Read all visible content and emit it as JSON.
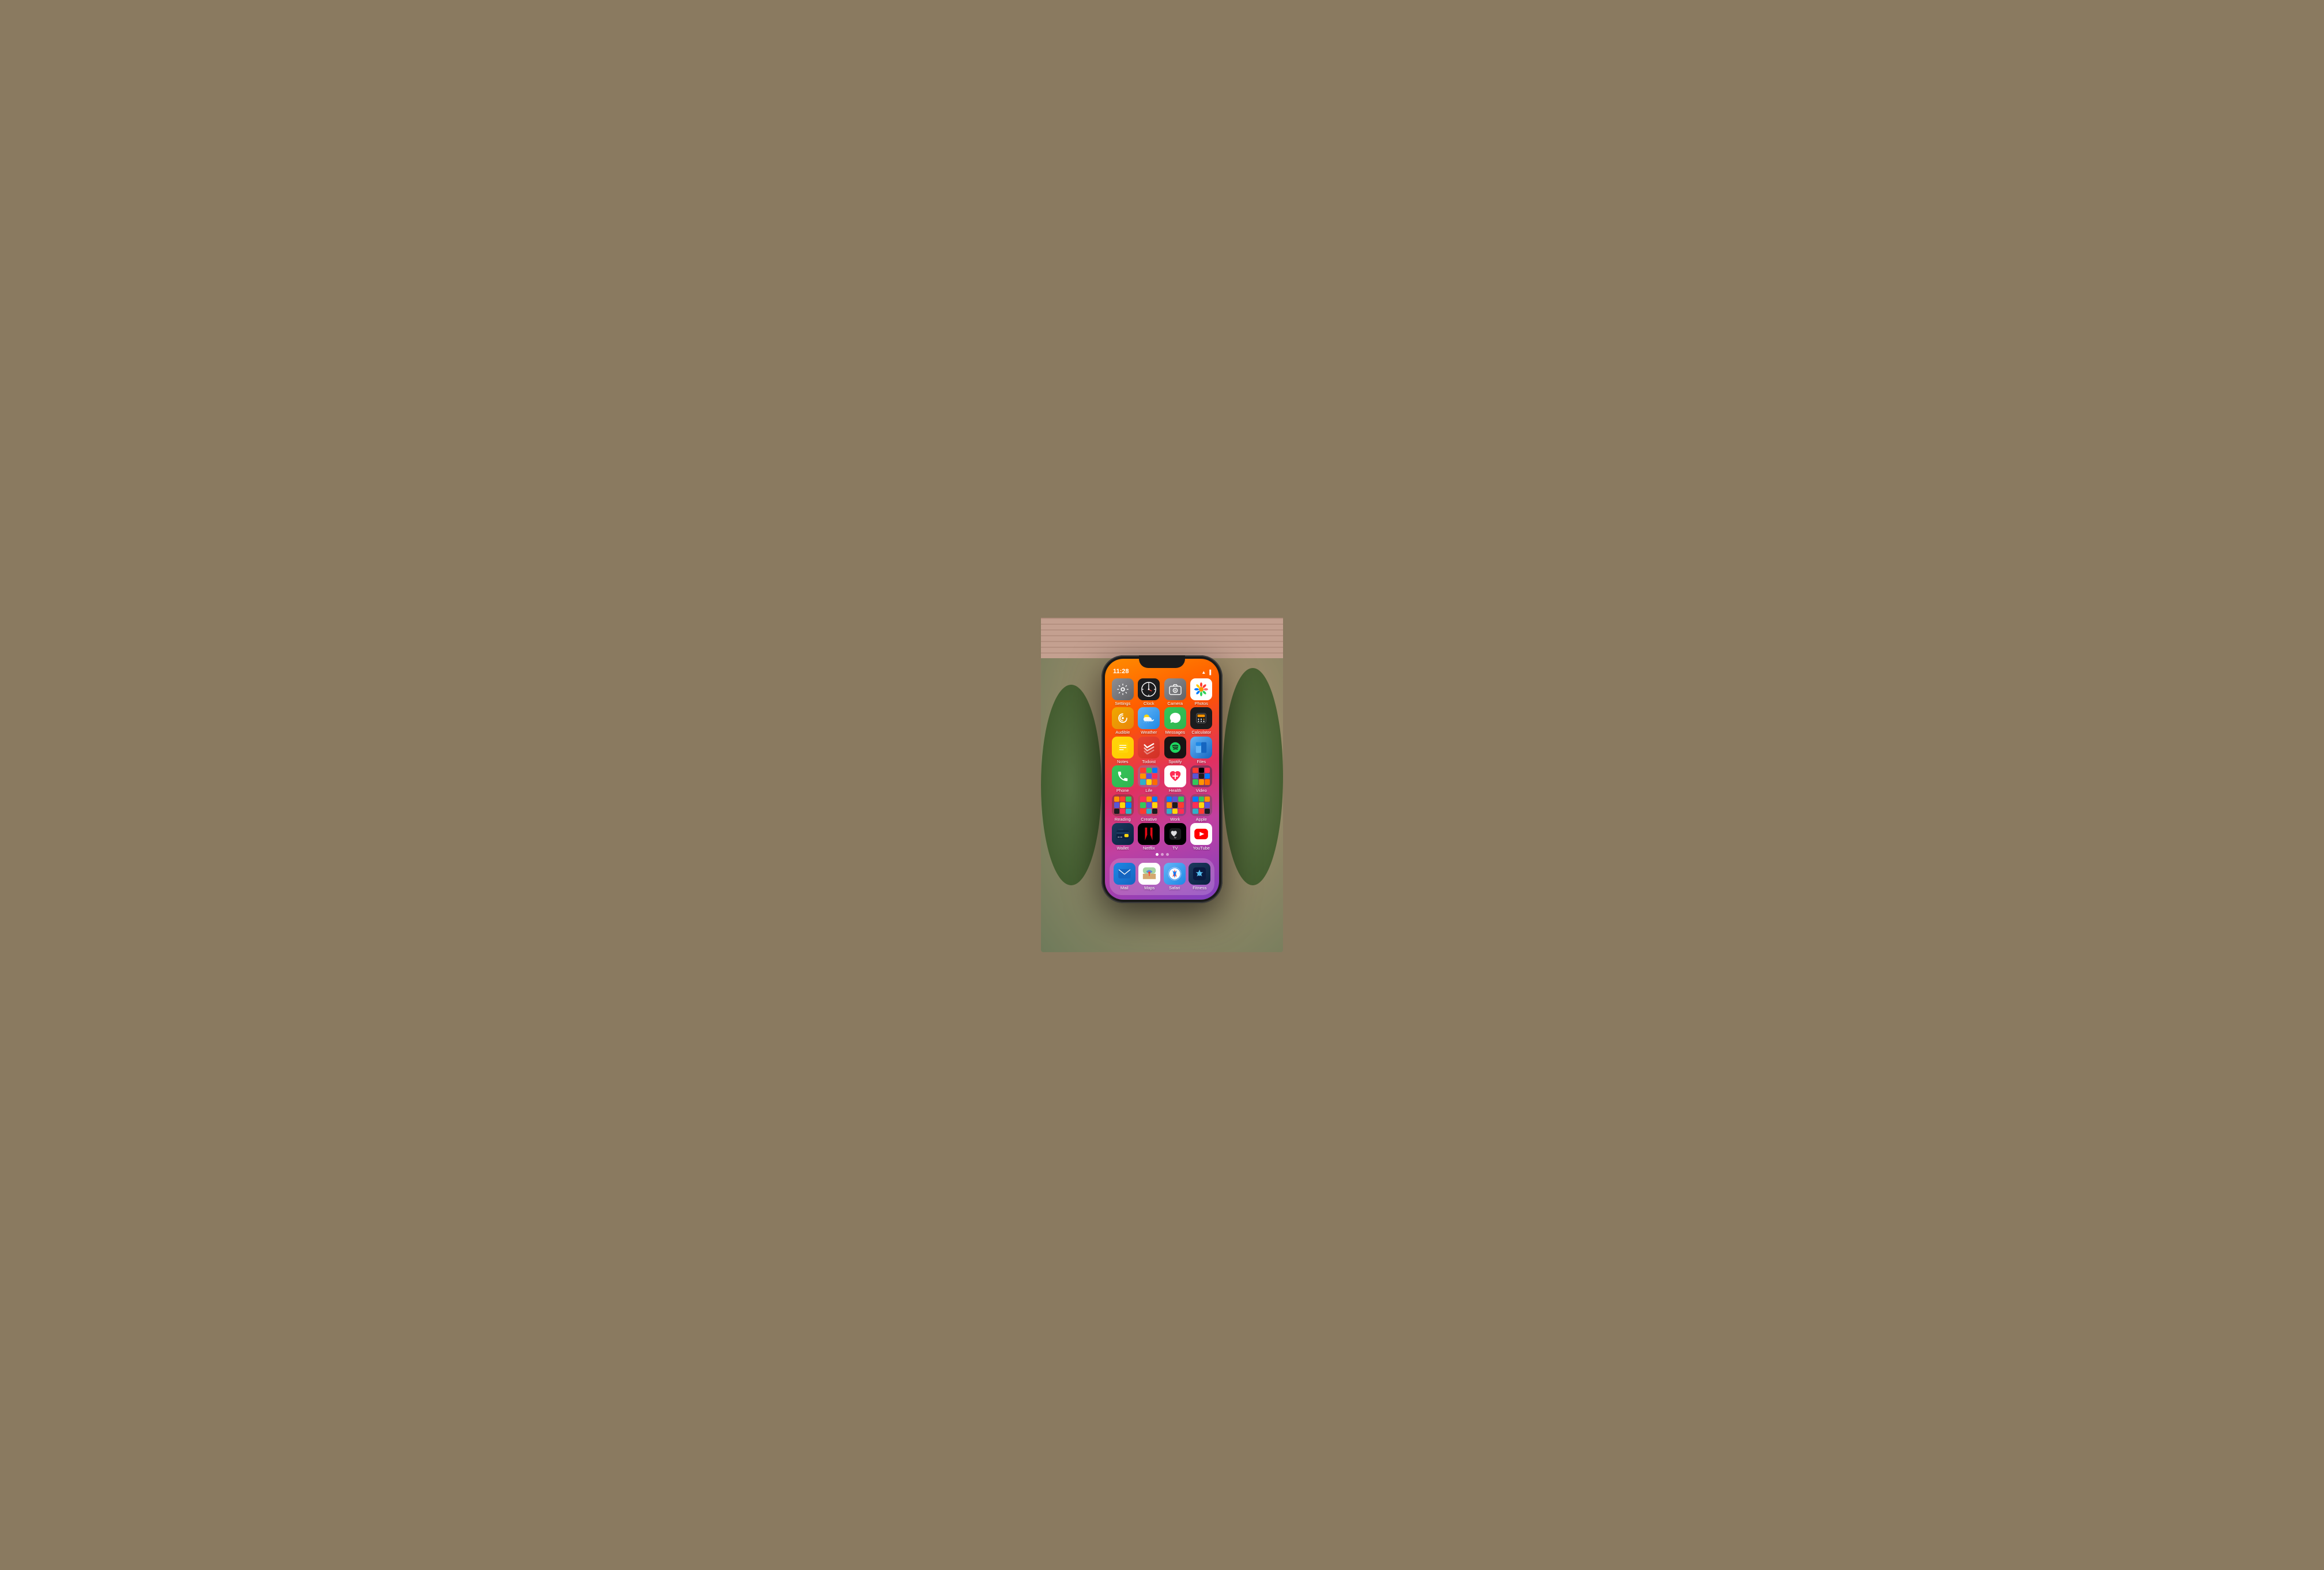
{
  "scene": {
    "background": "outdoor garden"
  },
  "phone": {
    "status_bar": {
      "time": "11:28",
      "wifi_icon": "wifi",
      "battery_icon": "battery"
    },
    "apps": {
      "row1": [
        {
          "id": "settings",
          "label": "Settings",
          "icon_class": "icon-settings"
        },
        {
          "id": "clock",
          "label": "Clock",
          "icon_class": "icon-clock"
        },
        {
          "id": "camera",
          "label": "Camera",
          "icon_class": "icon-camera"
        },
        {
          "id": "photos",
          "label": "Photos",
          "icon_class": "icon-photos"
        }
      ],
      "row2": [
        {
          "id": "audible",
          "label": "Audible",
          "icon_class": "icon-audible"
        },
        {
          "id": "weather",
          "label": "Weather",
          "icon_class": "icon-weather"
        },
        {
          "id": "messages",
          "label": "Messages",
          "icon_class": "icon-messages"
        },
        {
          "id": "calculator",
          "label": "Calculator",
          "icon_class": "icon-calculator"
        }
      ],
      "row3": [
        {
          "id": "notes",
          "label": "Notes",
          "icon_class": "icon-notes"
        },
        {
          "id": "todoist",
          "label": "Todoist",
          "icon_class": "icon-todoist"
        },
        {
          "id": "spotify",
          "label": "Spotify",
          "icon_class": "icon-spotify"
        },
        {
          "id": "files",
          "label": "Files",
          "icon_class": "icon-files"
        }
      ],
      "row4": [
        {
          "id": "phone",
          "label": "Phone",
          "icon_class": "icon-phone"
        },
        {
          "id": "life",
          "label": "Life",
          "icon_class": "icon-life",
          "is_folder": true
        },
        {
          "id": "health",
          "label": "Health",
          "icon_class": "icon-health"
        },
        {
          "id": "video",
          "label": "Video",
          "icon_class": "icon-video",
          "is_folder": true
        }
      ],
      "row5": [
        {
          "id": "reading",
          "label": "Reading",
          "icon_class": "icon-reading",
          "is_folder": true
        },
        {
          "id": "creative",
          "label": "Creative",
          "icon_class": "icon-creative",
          "is_folder": true
        },
        {
          "id": "work",
          "label": "Work",
          "icon_class": "icon-work",
          "is_folder": true
        },
        {
          "id": "apple",
          "label": "Apple",
          "icon_class": "icon-apple",
          "is_folder": true
        }
      ],
      "row6": [
        {
          "id": "wallet",
          "label": "Wallet",
          "icon_class": "icon-wallet"
        },
        {
          "id": "netflix",
          "label": "Netflix",
          "icon_class": "icon-netflix"
        },
        {
          "id": "appletv",
          "label": "TV",
          "icon_class": "icon-appletv"
        },
        {
          "id": "youtube",
          "label": "YouTube",
          "icon_class": "icon-youtube"
        }
      ]
    },
    "dock": [
      {
        "id": "mail",
        "label": "Mail",
        "icon_class": "icon-mail"
      },
      {
        "id": "maps",
        "label": "Maps",
        "icon_class": "icon-maps"
      },
      {
        "id": "safari",
        "label": "Safari",
        "icon_class": "icon-safari"
      },
      {
        "id": "fitness",
        "label": "Fitness",
        "icon_class": "icon-fitness"
      }
    ],
    "page_dots": [
      true,
      false,
      false
    ],
    "active_dot": 0
  }
}
